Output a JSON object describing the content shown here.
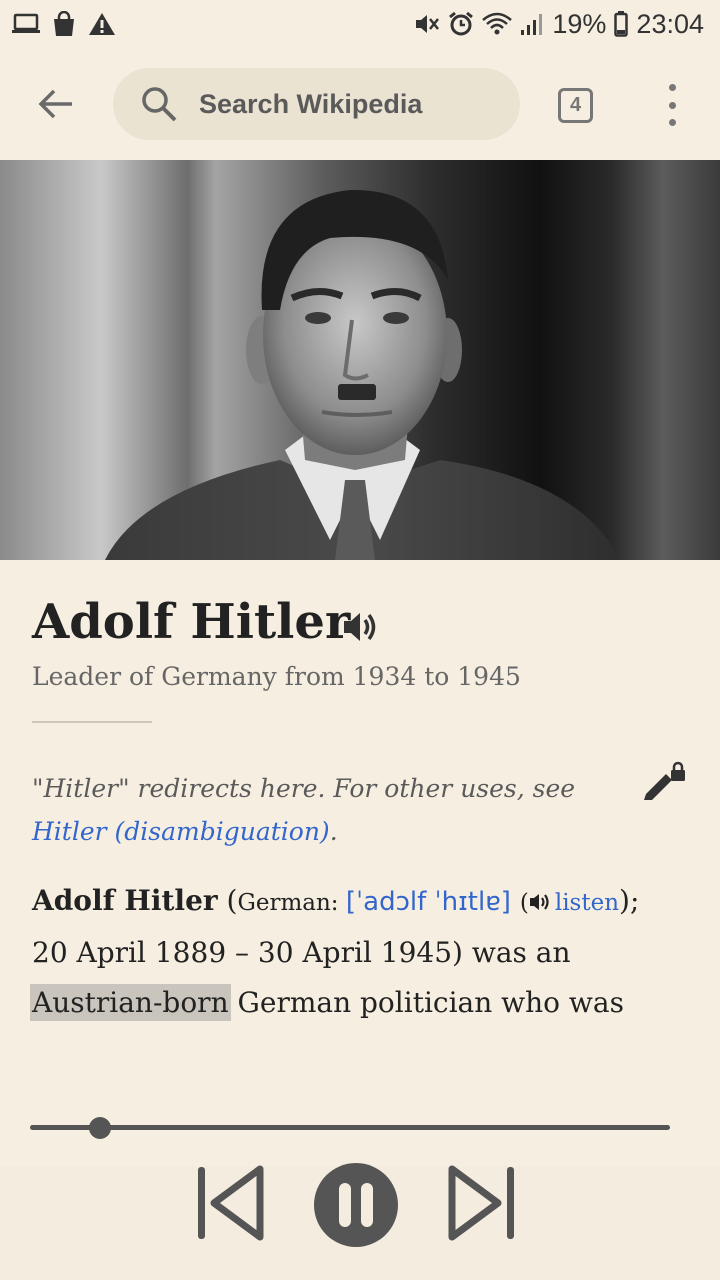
{
  "status_bar": {
    "battery": "19%",
    "time": "23:04"
  },
  "toolbar": {
    "search_placeholder": "Search Wikipedia",
    "tab_count": "4"
  },
  "article": {
    "title": "Adolf Hitler",
    "description": "Leader of Germany from 1934 to 1945",
    "hatnote": {
      "prefix": "\"Hitler\" redirects here. For other uses, see ",
      "link": "Hitler (disambiguation)",
      "suffix": "."
    },
    "lead": {
      "name": "Adolf Hitler",
      "paren_open": " (",
      "lang": "German: ",
      "ipa": "[ˈadɔlf ˈhɪtlɐ]",
      "listen": "listen",
      "after_listen": ");",
      "line2": "20 April 1889 – 30 April 1945) was an",
      "highlighted": "Austrian-born",
      "line3_rest": " German politician who was"
    }
  },
  "icons": {
    "status_left": [
      "laptop-icon",
      "shopping-bag-icon",
      "warning-icon"
    ],
    "status_right": [
      "mute-icon",
      "alarm-icon",
      "wifi-icon",
      "signal-icon",
      "battery-icon"
    ],
    "toolbar": [
      "back-arrow-icon",
      "search-icon",
      "more-vertical-icon"
    ],
    "article": [
      "speaker-icon",
      "edit-locked-icon"
    ],
    "player": [
      "skip-previous-icon",
      "pause-icon",
      "skip-next-icon"
    ]
  },
  "player": {
    "progress": 0.11
  }
}
